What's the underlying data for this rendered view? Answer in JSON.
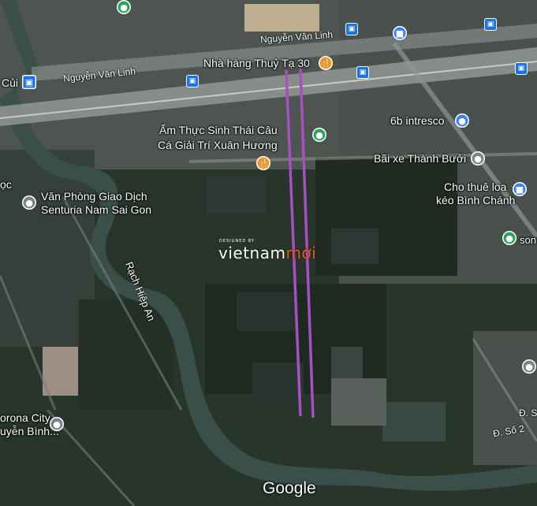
{
  "map": {
    "streets": {
      "nguyen_van_linh_1": "Nguyễn Văn Linh",
      "nguyen_van_linh_2": "Nguyễn Văn Linh",
      "rach_hiep_an": "Rạch Hiệp An",
      "d_so_2": "Đ. Số 2",
      "d_s_partial": "Đ. S"
    },
    "places": {
      "cui": "Củi",
      "nha_hang": "Nhà hàng Thuỷ Tạ 30",
      "am_thuc_line1": "Ẩm Thực Sinh Thái Câu",
      "am_thuc_line2": "Cá Giải Trí Xuân Hương",
      "intresco": "6b intresco",
      "bai_xe": "Bãi xe Thành Bưởi",
      "cho_thue_line1": "Cho thuê loa",
      "cho_thue_line2": "kéo Bình Chánh",
      "van_phong_line1": "Văn Phòng Giao Dịch",
      "van_phong_line2": "Senturia Nam Sai Gon",
      "oc_partial": "ọc",
      "corona_line1": "orona City",
      "corona_line2": "uyễn Bình...",
      "son_partial": "son"
    },
    "watermark": {
      "sub": "DESIGNED BY",
      "text_main": "vietnam",
      "text_accent": "mới"
    },
    "google_logo": "Google",
    "colors": {
      "route_line": "#a84fc2",
      "water": "#3b4f4a",
      "vegetation": "#2a3a2a",
      "pin_orange": "#f29a1d",
      "pin_green": "#2ea35b",
      "pin_gray": "#7b8288",
      "pin_blue": "#3b82f6",
      "bus": "#1a73e8"
    }
  }
}
